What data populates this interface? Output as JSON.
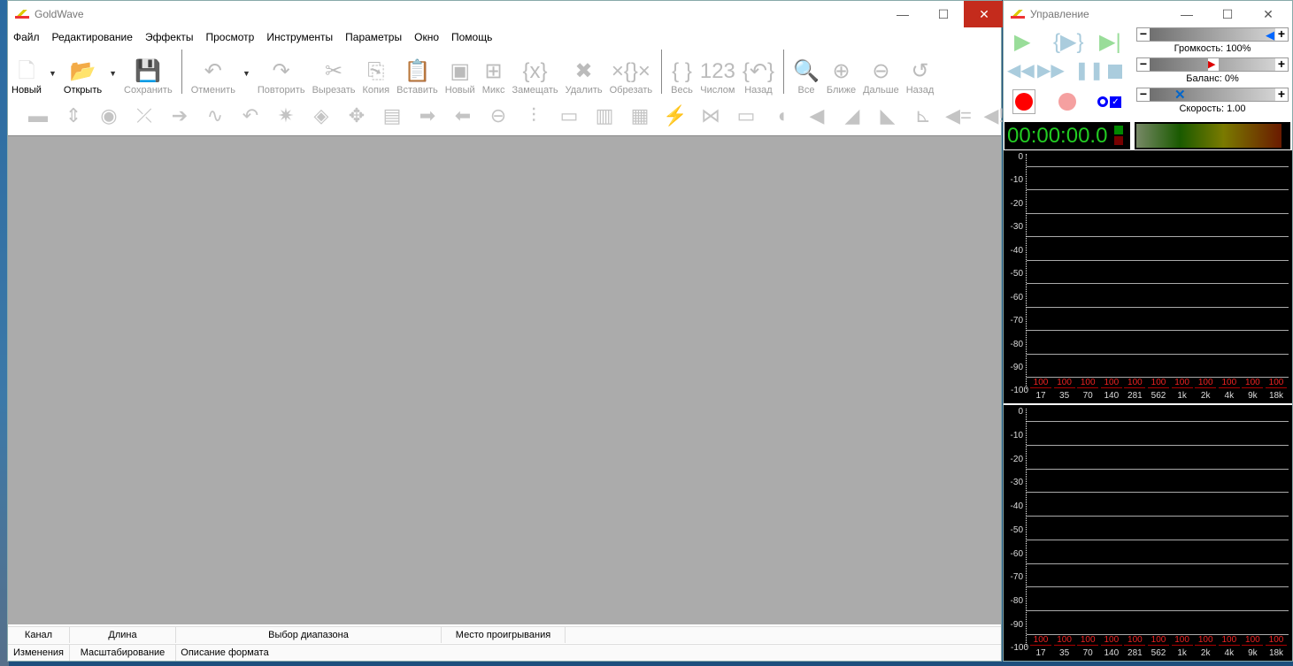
{
  "main_window": {
    "title": "GoldWave",
    "controls": {
      "minimize": "—",
      "maximize": "☐",
      "close": "✕"
    }
  },
  "menu": [
    "Файл",
    "Редактирование",
    "Эффекты",
    "Просмотр",
    "Инструменты",
    "Параметры",
    "Окно",
    "Помощь"
  ],
  "toolbar": [
    {
      "label": "Новый",
      "icon": "new-file-icon",
      "glyph": "🗋",
      "enabled": true,
      "dropdown": true
    },
    {
      "label": "Открыть",
      "icon": "open-folder-icon",
      "glyph": "📂",
      "enabled": true,
      "dropdown": true
    },
    {
      "label": "Сохранить",
      "icon": "save-icon",
      "glyph": "💾",
      "enabled": false
    },
    {
      "label": "Отменить",
      "icon": "undo-icon",
      "glyph": "↶",
      "enabled": false,
      "dropdown": true,
      "sep_before": true
    },
    {
      "label": "Повторить",
      "icon": "redo-icon",
      "glyph": "↷",
      "enabled": false
    },
    {
      "label": "Вырезать",
      "icon": "cut-icon",
      "glyph": "✂",
      "enabled": false
    },
    {
      "label": "Копия",
      "icon": "copy-icon",
      "glyph": "⎘",
      "enabled": false
    },
    {
      "label": "Вставить",
      "icon": "paste-icon",
      "glyph": "📋",
      "enabled": false
    },
    {
      "label": "Новый",
      "icon": "paste-new-icon",
      "glyph": "▣",
      "enabled": false
    },
    {
      "label": "Микс",
      "icon": "mix-icon",
      "glyph": "⊞",
      "enabled": false
    },
    {
      "label": "Замещать",
      "icon": "replace-icon",
      "glyph": "{x}",
      "enabled": false
    },
    {
      "label": "Удалить",
      "icon": "delete-icon",
      "glyph": "✖",
      "enabled": false
    },
    {
      "label": "Обрезать",
      "icon": "trim-icon",
      "glyph": "×{}×",
      "enabled": false
    },
    {
      "label": "Весь",
      "icon": "select-all-icon",
      "glyph": "{ }",
      "enabled": false,
      "sep_before": true
    },
    {
      "label": "Числом",
      "icon": "select-numeric-icon",
      "glyph": "123",
      "enabled": false
    },
    {
      "label": "Назад",
      "icon": "select-back-icon",
      "glyph": "{↶}",
      "enabled": false
    },
    {
      "label": "Все",
      "icon": "zoom-all-icon",
      "glyph": "🔍",
      "enabled": false,
      "sep_before": true
    },
    {
      "label": "Ближе",
      "icon": "zoom-in-icon",
      "glyph": "⊕",
      "enabled": false
    },
    {
      "label": "Дальше",
      "icon": "zoom-out-icon",
      "glyph": "⊖",
      "enabled": false
    },
    {
      "label": "Назад",
      "icon": "zoom-back-icon",
      "glyph": "↺",
      "enabled": false
    }
  ],
  "effects_toolbar": [
    "▬",
    "⇕",
    "◉",
    "⤫",
    "➔",
    "∿",
    "↶",
    "✷",
    "◈",
    "✥",
    "▤",
    "➡",
    "⬅",
    "⊖",
    "⫶",
    "▭",
    "▥",
    "▦",
    "⚡",
    "⋈",
    "▭",
    "◖",
    "◀",
    "◢",
    "◣",
    "⊾",
    "◀=",
    "◀!"
  ],
  "status_bar": {
    "row1": [
      "Канал",
      "Длина",
      "Выбор диапазона",
      "Место проигрывания",
      ""
    ],
    "row2": [
      "Изменения",
      "Масштабирование",
      "Описание формата"
    ]
  },
  "control_window": {
    "title": "Управление",
    "volume_label": "Громкость: 100%",
    "volume": 100,
    "balance_label": "Баланс: 0%",
    "balance": 0,
    "speed_label": "Скорость: 1.00",
    "speed": 1.0,
    "time": "00:00:00.0",
    "spectrum": {
      "db_ticks": [
        "0",
        "-10",
        "-20",
        "-30",
        "-40",
        "-50",
        "-60",
        "-70",
        "-80",
        "-90",
        "-100"
      ],
      "freq_labels": [
        "17",
        "35",
        "70",
        "140",
        "281",
        "562",
        "1k",
        "2k",
        "4k",
        "9k",
        "18k"
      ],
      "peak_values": [
        "100",
        "100",
        "100",
        "100",
        "100",
        "100",
        "100",
        "100",
        "100",
        "100",
        "100"
      ]
    }
  }
}
